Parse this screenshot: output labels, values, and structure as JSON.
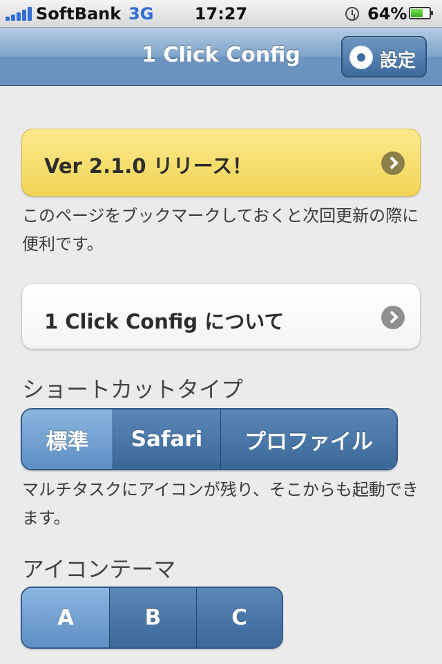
{
  "status_bar": {
    "carrier": "SoftBank",
    "network": "3G",
    "time": "17:27",
    "battery": "64%",
    "battery_level": 0.64,
    "signal_icon": "signal-bars-icon",
    "alarm_icon": "alarm-clock-icon"
  },
  "nav": {
    "title": "1 Click Config",
    "settings_label": "設定",
    "settings_icon": "gear-icon"
  },
  "release_banner": {
    "label": "Ver 2.1.0 リリース！",
    "note": "このページをブックマークしておくと次回更新の際に便利です。"
  },
  "about": {
    "label": "1 Click Config について"
  },
  "shortcut_type": {
    "heading": "ショートカットタイプ",
    "options": [
      "標準",
      "Safari",
      "プロファイル"
    ],
    "selected": "標準",
    "note": "マルチタスクにアイコンが残り、そこからも起動できます。"
  },
  "icon_theme": {
    "heading": "アイコンテーマ",
    "options": [
      "A",
      "B",
      "C"
    ],
    "selected": "A"
  },
  "colors": {
    "accent_blue": "#3a6898",
    "selected_blue": "#6e9fd2",
    "banner_yellow": "#f6de6c"
  }
}
